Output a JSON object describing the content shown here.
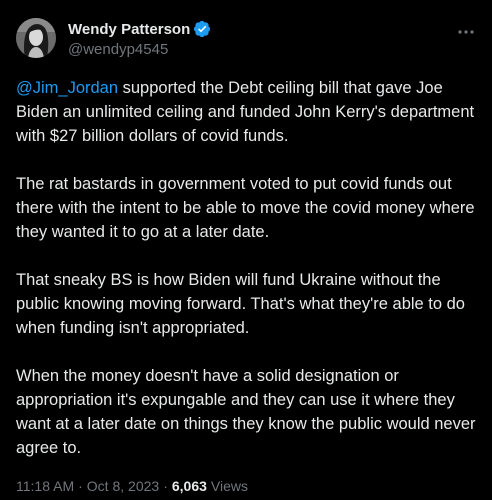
{
  "author": {
    "display_name": "Wendy Patterson",
    "handle": "@wendyp4545",
    "verified": true
  },
  "tweet": {
    "mention": "@Jim_Jordan",
    "p1_rest": " supported the Debt ceiling bill that gave Joe Biden an unlimited ceiling and funded John Kerry's department with $27 billion dollars of covid funds.",
    "p2": "The rat bastards in government voted to put covid funds out there with the intent to be able to move the covid money where they wanted it to go at a later date.",
    "p3": "That sneaky BS is how Biden will fund Ukraine without the public knowing moving forward. That's what they're able to do when funding isn't appropriated.",
    "p4": "When the money doesn't have a solid designation or appropriation it's expungable and they can use it where they want at a later date on things they know the public would never agree to."
  },
  "meta": {
    "time": "11:18 AM",
    "date": "Oct 8, 2023",
    "separator": "·",
    "views_count": "6,063",
    "views_label": "Views"
  },
  "colors": {
    "background": "#000000",
    "text": "#e7e9ea",
    "secondary": "#71767b",
    "accent": "#1d9bf0"
  },
  "icons": {
    "verified": "verified-badge-icon",
    "more": "more-options-icon",
    "avatar": "avatar-photo"
  }
}
